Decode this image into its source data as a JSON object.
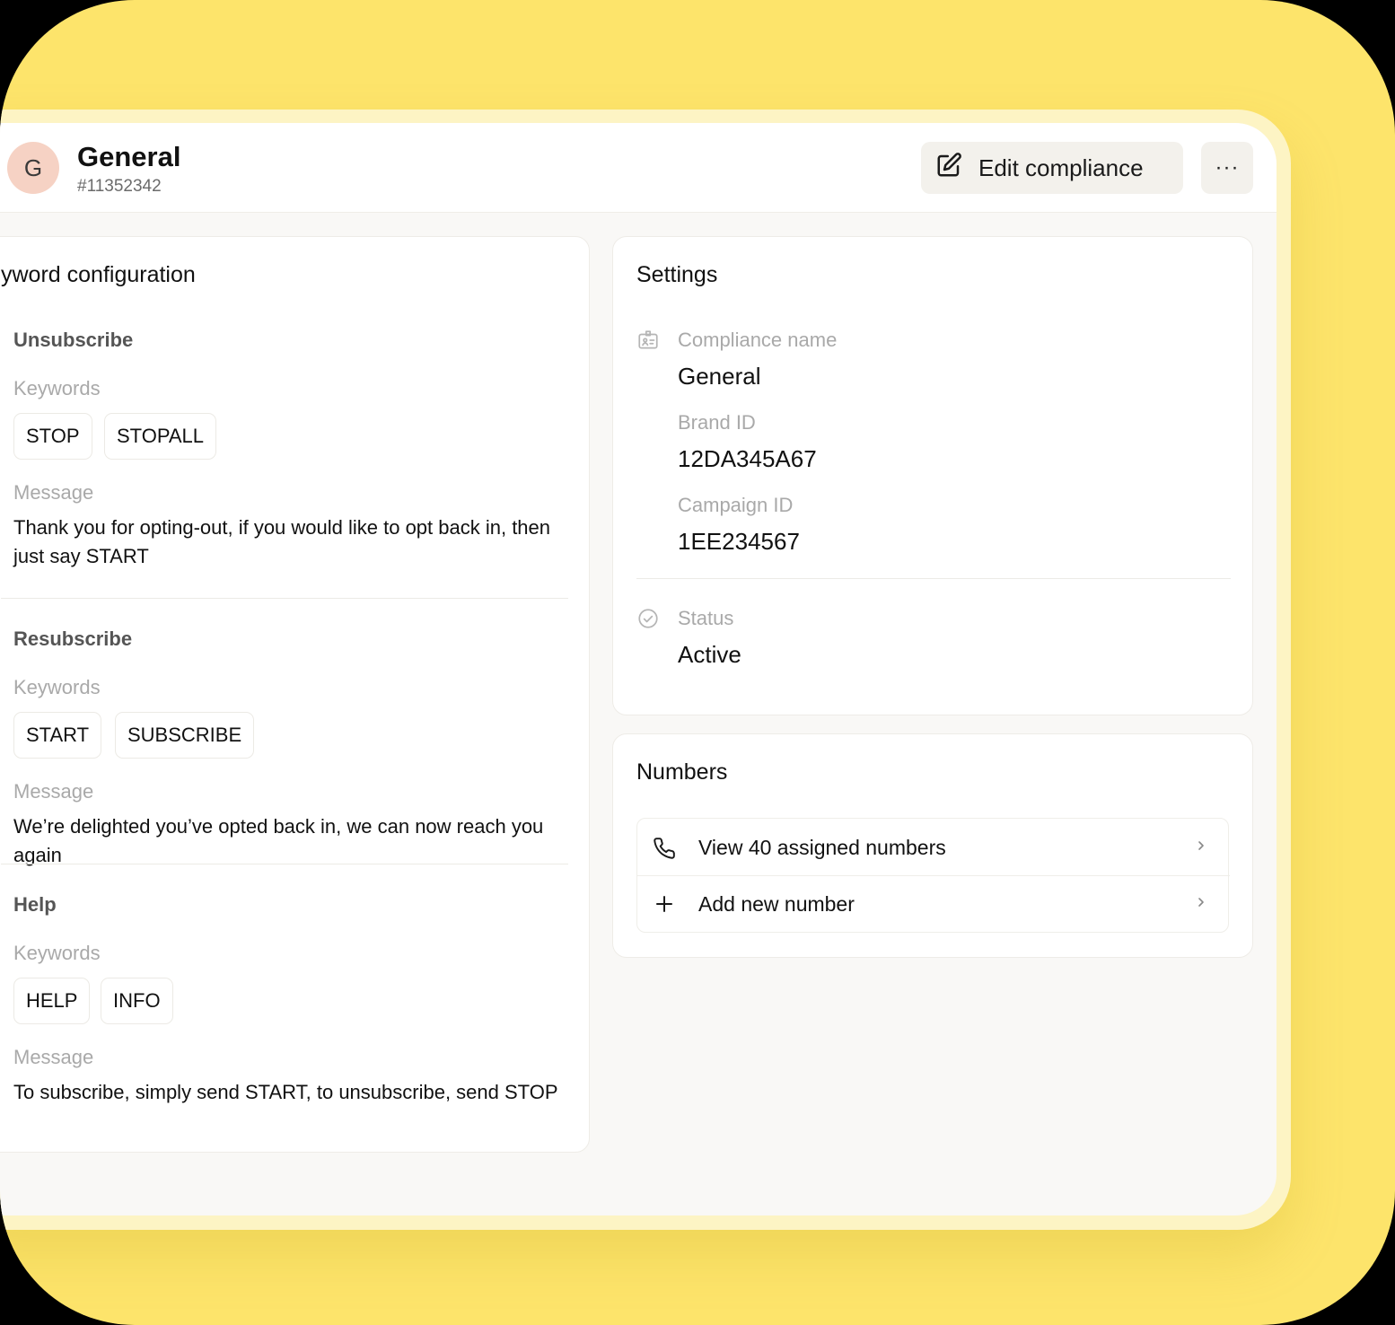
{
  "header": {
    "avatar_letter": "G",
    "title": "General",
    "id": "#11352342",
    "edit_label": "Edit compliance",
    "more_label": "···"
  },
  "keyword_config": {
    "title": "yword configuration",
    "sections": [
      {
        "title": "Unsubscribe",
        "keywords_label": "Keywords",
        "keywords": [
          "STOP",
          "STOPALL"
        ],
        "message_label": "Message",
        "message": "Thank you for opting-out, if you would like to opt back in, then just say START"
      },
      {
        "title": "Resubscribe",
        "keywords_label": "Keywords",
        "keywords": [
          "START",
          "SUBSCRIBE"
        ],
        "message_label": "Message",
        "message": "We’re delighted you’ve opted back in, we can now reach you again"
      },
      {
        "title": "Help",
        "keywords_label": "Keywords",
        "keywords": [
          "HELP",
          "INFO"
        ],
        "message_label": "Message",
        "message": "To subscribe, simply send START, to unsubscribe, send STOP"
      }
    ]
  },
  "settings": {
    "title": "Settings",
    "compliance_name_label": "Compliance name",
    "compliance_name": "General",
    "brand_id_label": "Brand ID",
    "brand_id": "12DA345A67",
    "campaign_id_label": "Campaign ID",
    "campaign_id": "1EE234567",
    "status_label": "Status",
    "status": "Active"
  },
  "numbers": {
    "title": "Numbers",
    "items": [
      {
        "label": "View 40 assigned numbers",
        "icon": "phone-icon"
      },
      {
        "label": "Add new number",
        "icon": "plus-icon"
      }
    ]
  },
  "colors": {
    "background": "#fde46b",
    "avatar": "#f6d2c4",
    "button": "#f3f1ec"
  }
}
